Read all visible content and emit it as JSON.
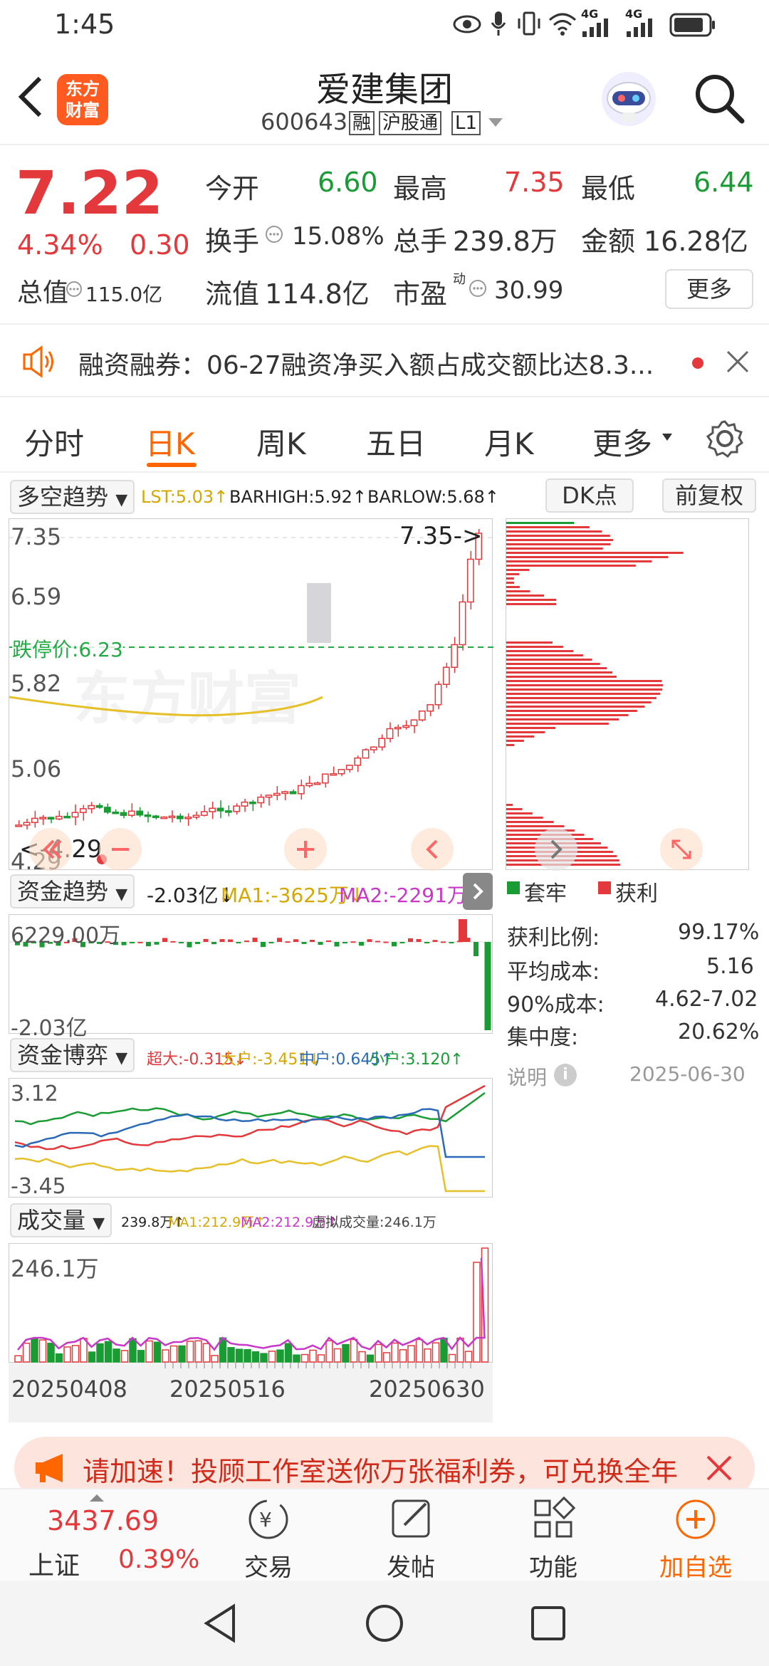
{
  "status": {
    "time": "1:45",
    "net1": "4G",
    "net2": "4G"
  },
  "header": {
    "title": "爱建集团",
    "code": "600643",
    "tag1": "融",
    "tag2": "沪股通",
    "tag3": "L1",
    "logo": "东方\n财富"
  },
  "quote": {
    "price": "7.22",
    "pct": "4.34%",
    "chg": "0.30",
    "open_l": "今开",
    "open": "6.60",
    "high_l": "最高",
    "high": "7.35",
    "low_l": "最低",
    "low": "6.44",
    "turn_l": "换手",
    "turn": "15.08%",
    "vol_l": "总手",
    "vol": "239.8万",
    "amt_l": "金额",
    "amt": "16.28亿",
    "mcap_l": "总值",
    "mcap": "115.0亿",
    "float_l": "流值",
    "float": "114.8亿",
    "pe_l": "市盈",
    "pe_sup": "动",
    "pe": "30.99",
    "more": "更多"
  },
  "notice": {
    "text": "融资融券：06-27融资净买入额占成交额比达8.3..."
  },
  "tabs": [
    "分时",
    "日K",
    "周K",
    "五日",
    "月K",
    "更多"
  ],
  "kline": {
    "indicator": "多空趋势",
    "lst": "LST:5.03↑",
    "barhigh": "BARHIGH:5.92↑",
    "barlow": "BARLOW:5.68↑",
    "dk": "DK点",
    "adj": "前复权",
    "y1": "7.35",
    "y2": "6.59",
    "y3": "5.82",
    "y4": "5.06",
    "y5": "4.29",
    "limit": "跌停价:6.23",
    "maxmark": "7.35->",
    "minmark": "<-4.29",
    "watermark": "东方财富"
  },
  "fund": {
    "label": "资金趋势",
    "v": "-2.03亿↓",
    "ma1": "MA1:-3625万↓",
    "ma2": "MA2:-2291万↓",
    "top": "6229.00万",
    "bottom": "-2.03亿"
  },
  "game": {
    "label": "资金博弈",
    "sup": "超大:-0.315↓",
    "big": "大户:-3.451↓",
    "mid": "中户:0.645↑",
    "small": "小户:3.120↑",
    "top": "3.12",
    "bottom": "-3.45"
  },
  "volume": {
    "label": "成交量",
    "v": "239.8万↑",
    "ma1": "MA1:212.9万↑",
    "ma2": "MA2:212.9万↑",
    "virt": "虚拟成交量:246.1万",
    "top": "246.1万",
    "d1": "20250408",
    "d2": "20250516",
    "d3": "20250630"
  },
  "chips": {
    "leg1": "套牢",
    "leg2": "获利",
    "r1l": "获利比例:",
    "r1": "99.17%",
    "r2l": "平均成本:",
    "r2": "5.16",
    "r3l": "90%成本:",
    "r3": "4.62-7.02",
    "r4l": "集中度:",
    "r4": "20.62%",
    "note": "说明",
    "date": "2025-06-30"
  },
  "banner": {
    "text": "请加速！投顾工作室送你万张福利券，可兑换全年"
  },
  "bottom": {
    "idx": "3437.69",
    "idxname": "上证",
    "idxpct": "0.39%",
    "n1": "交易",
    "n2": "发帖",
    "n3": "功能",
    "n4": "加自选"
  },
  "colors": {
    "up": "#e4393c",
    "down": "#1a9c35",
    "accent": "#ff6600"
  }
}
